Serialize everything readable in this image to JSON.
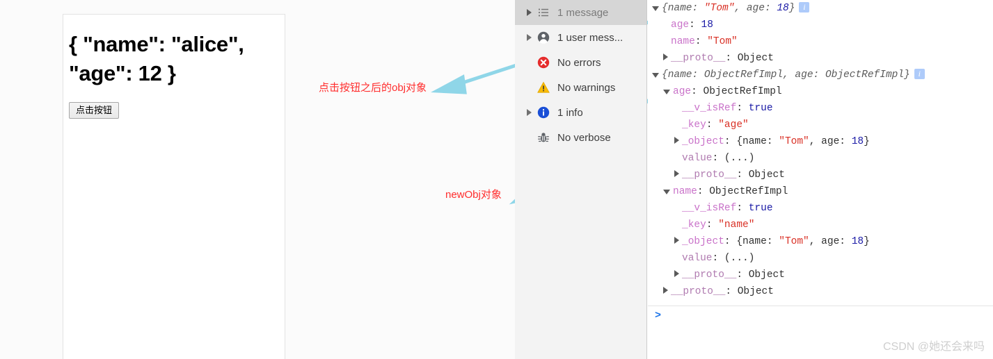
{
  "page": {
    "json_text": "{ \"name\": \"alice\", \"age\": 12 }",
    "button_label": "点击按钮"
  },
  "annotations": {
    "obj_label": "点击按钮之后的obj对象",
    "newobj_label": "newObj对象",
    "arrow_color": "#8fd6e8"
  },
  "sidebar": {
    "items": [
      {
        "label": "1 message",
        "icon": "list-icon",
        "twisty": true,
        "selected": true
      },
      {
        "label": "1 user mess...",
        "icon": "user-icon",
        "twisty": true,
        "selected": false
      },
      {
        "label": "No errors",
        "icon": "error-icon",
        "twisty": false,
        "selected": false
      },
      {
        "label": "No warnings",
        "icon": "warning-icon",
        "twisty": false,
        "selected": false
      },
      {
        "label": "1 info",
        "icon": "info-icon",
        "twisty": true,
        "selected": false
      },
      {
        "label": "No verbose",
        "icon": "bug-icon",
        "twisty": false,
        "selected": false
      }
    ]
  },
  "console": {
    "prompt": ">",
    "rows": [
      {
        "indent": 0,
        "twisty": "open",
        "badge": true,
        "parts": [
          {
            "t": "{name: ",
            "c": "preview"
          },
          {
            "t": "\"Tom\"",
            "c": "str-i"
          },
          {
            "t": ", age: ",
            "c": "preview"
          },
          {
            "t": "18",
            "c": "num-i"
          },
          {
            "t": "}",
            "c": "preview"
          }
        ]
      },
      {
        "indent": 1,
        "twisty": "none",
        "badge": false,
        "parts": [
          {
            "t": "age",
            "c": "key"
          },
          {
            "t": ": ",
            "c": "plain"
          },
          {
            "t": "18",
            "c": "num"
          }
        ]
      },
      {
        "indent": 1,
        "twisty": "none",
        "badge": false,
        "parts": [
          {
            "t": "name",
            "c": "key"
          },
          {
            "t": ": ",
            "c": "plain"
          },
          {
            "t": "\"Tom\"",
            "c": "str"
          }
        ]
      },
      {
        "indent": 1,
        "twisty": "closed",
        "badge": false,
        "parts": [
          {
            "t": "__proto__",
            "c": "dim"
          },
          {
            "t": ": ",
            "c": "plain"
          },
          {
            "t": "Object",
            "c": "plain"
          }
        ]
      },
      {
        "indent": 0,
        "twisty": "open",
        "badge": true,
        "parts": [
          {
            "t": "{name: ObjectRefImpl, age: ObjectRefImpl}",
            "c": "preview"
          }
        ]
      },
      {
        "indent": 1,
        "twisty": "open",
        "badge": false,
        "parts": [
          {
            "t": "age",
            "c": "key"
          },
          {
            "t": ": ",
            "c": "plain"
          },
          {
            "t": "ObjectRefImpl",
            "c": "plain"
          }
        ]
      },
      {
        "indent": 2,
        "twisty": "none",
        "badge": false,
        "parts": [
          {
            "t": "__v_isRef",
            "c": "key"
          },
          {
            "t": ": ",
            "c": "plain"
          },
          {
            "t": "true",
            "c": "bool"
          }
        ]
      },
      {
        "indent": 2,
        "twisty": "none",
        "badge": false,
        "parts": [
          {
            "t": "_key",
            "c": "key"
          },
          {
            "t": ": ",
            "c": "plain"
          },
          {
            "t": "\"age\"",
            "c": "str"
          }
        ]
      },
      {
        "indent": 2,
        "twisty": "closed",
        "badge": false,
        "parts": [
          {
            "t": "_object",
            "c": "key"
          },
          {
            "t": ": ",
            "c": "plain"
          },
          {
            "t": "{name: ",
            "c": "plain"
          },
          {
            "t": "\"Tom\"",
            "c": "str"
          },
          {
            "t": ", age: ",
            "c": "plain"
          },
          {
            "t": "18",
            "c": "num"
          },
          {
            "t": "}",
            "c": "plain"
          }
        ]
      },
      {
        "indent": 2,
        "twisty": "none",
        "badge": false,
        "parts": [
          {
            "t": "value",
            "c": "dim"
          },
          {
            "t": ": ",
            "c": "plain"
          },
          {
            "t": "(...)",
            "c": "plain"
          }
        ]
      },
      {
        "indent": 2,
        "twisty": "closed",
        "badge": false,
        "parts": [
          {
            "t": "__proto__",
            "c": "dim"
          },
          {
            "t": ": ",
            "c": "plain"
          },
          {
            "t": "Object",
            "c": "plain"
          }
        ]
      },
      {
        "indent": 1,
        "twisty": "open",
        "badge": false,
        "parts": [
          {
            "t": "name",
            "c": "key"
          },
          {
            "t": ": ",
            "c": "plain"
          },
          {
            "t": "ObjectRefImpl",
            "c": "plain"
          }
        ]
      },
      {
        "indent": 2,
        "twisty": "none",
        "badge": false,
        "parts": [
          {
            "t": "__v_isRef",
            "c": "key"
          },
          {
            "t": ": ",
            "c": "plain"
          },
          {
            "t": "true",
            "c": "bool"
          }
        ]
      },
      {
        "indent": 2,
        "twisty": "none",
        "badge": false,
        "parts": [
          {
            "t": "_key",
            "c": "key"
          },
          {
            "t": ": ",
            "c": "plain"
          },
          {
            "t": "\"name\"",
            "c": "str"
          }
        ]
      },
      {
        "indent": 2,
        "twisty": "closed",
        "badge": false,
        "parts": [
          {
            "t": "_object",
            "c": "key"
          },
          {
            "t": ": ",
            "c": "plain"
          },
          {
            "t": "{name: ",
            "c": "plain"
          },
          {
            "t": "\"Tom\"",
            "c": "str"
          },
          {
            "t": ", age: ",
            "c": "plain"
          },
          {
            "t": "18",
            "c": "num"
          },
          {
            "t": "}",
            "c": "plain"
          }
        ]
      },
      {
        "indent": 2,
        "twisty": "none",
        "badge": false,
        "parts": [
          {
            "t": "value",
            "c": "dim"
          },
          {
            "t": ": ",
            "c": "plain"
          },
          {
            "t": "(...)",
            "c": "plain"
          }
        ]
      },
      {
        "indent": 2,
        "twisty": "closed",
        "badge": false,
        "parts": [
          {
            "t": "__proto__",
            "c": "dim"
          },
          {
            "t": ": ",
            "c": "plain"
          },
          {
            "t": "Object",
            "c": "plain"
          }
        ]
      },
      {
        "indent": 1,
        "twisty": "closed",
        "badge": false,
        "parts": [
          {
            "t": "__proto__",
            "c": "dim"
          },
          {
            "t": ": ",
            "c": "plain"
          },
          {
            "t": "Object",
            "c": "plain"
          }
        ]
      }
    ]
  },
  "watermark": {
    "text": "CSDN @她还会来吗"
  }
}
